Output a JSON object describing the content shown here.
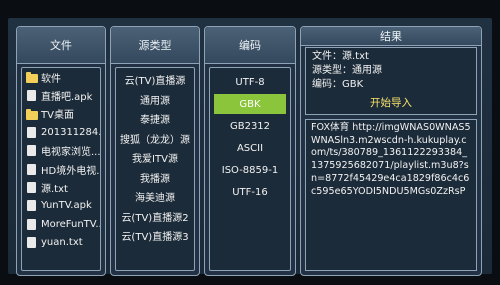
{
  "panels": {
    "files": {
      "header": "文件",
      "items": [
        {
          "label": "软件",
          "icon": "folder-icon"
        },
        {
          "label": "直播吧.apk",
          "icon": "file-icon"
        },
        {
          "label": "TV桌面",
          "icon": "folder-icon"
        },
        {
          "label": "201311284...",
          "icon": "file-icon"
        },
        {
          "label": "电视家浏览...",
          "icon": "file-icon"
        },
        {
          "label": "HD境外电视...",
          "icon": "file-icon"
        },
        {
          "label": "源.txt",
          "icon": "file-icon"
        },
        {
          "label": "YunTV.apk",
          "icon": "file-icon"
        },
        {
          "label": "MoreFunTV...",
          "icon": "file-icon"
        },
        {
          "label": "yuan.txt",
          "icon": "file-icon"
        }
      ]
    },
    "types": {
      "header": "源类型",
      "items": [
        "云(TV)直播源",
        "通用源",
        "泰捷源",
        "搜狐（龙龙）源",
        "我爱ITV源",
        "我播源",
        "海美迪源",
        "云(TV)直播源2",
        "云(TV)直播源3"
      ]
    },
    "encoding": {
      "header": "编码",
      "items": [
        "UTF-8",
        "GBK",
        "GB2312",
        "ASCII",
        "ISO-8859-1",
        "UTF-16"
      ],
      "selected_index": 1
    },
    "result": {
      "header": "结果",
      "file_line": "文件：源.txt",
      "type_line": "源类型：通用源",
      "enc_line": "编码：GBK",
      "import_button": "开始导入",
      "content": "FOX体育 http://imgWNAS0WNAS5WNASln3.m2wscdn-h.kukuplay.com/ts/380789_1361122293384_1375925682071/playlist.m3u8?sn=8772f45429e4ca1829f86c4c6c595e65YODI5NDU5MGs0ZzRsP"
    }
  },
  "colors": {
    "selected": "#8ac53b",
    "import_text": "#f7e26b",
    "folder": "#f3cf5a"
  }
}
